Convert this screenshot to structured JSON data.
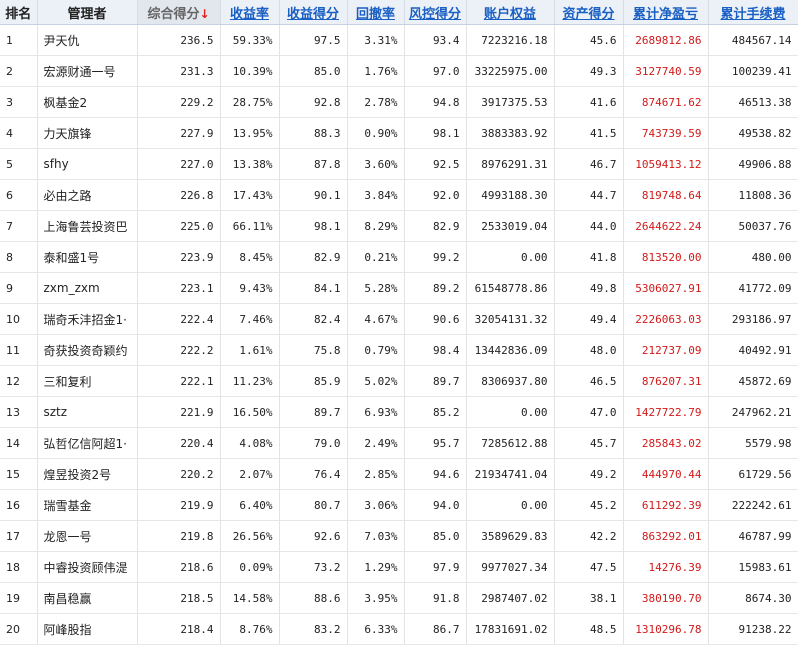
{
  "headers": {
    "rank": "排名",
    "manager": "管理者",
    "score": "综合得分",
    "sort_arrow": "↓",
    "return_rate": "收益率",
    "return_score": "收益得分",
    "drawdown": "回撤率",
    "risk_score": "风控得分",
    "equity": "账户权益",
    "asset_score": "资产得分",
    "net_pnl": "累计净盈亏",
    "fees": "累计手续费"
  },
  "rows": [
    {
      "rank": "1",
      "manager": "尹天仇",
      "score": "236.5",
      "return_rate": "59.33%",
      "return_score": "97.5",
      "drawdown": "3.31%",
      "risk_score": "93.4",
      "equity": "7223216.18",
      "asset_score": "45.6",
      "net_pnl": "2689812.86",
      "fees": "484567.14"
    },
    {
      "rank": "2",
      "manager": "宏源财通一号",
      "score": "231.3",
      "return_rate": "10.39%",
      "return_score": "85.0",
      "drawdown": "1.76%",
      "risk_score": "97.0",
      "equity": "33225975.00",
      "asset_score": "49.3",
      "net_pnl": "3127740.59",
      "fees": "100239.41"
    },
    {
      "rank": "3",
      "manager": "枫基金2",
      "score": "229.2",
      "return_rate": "28.75%",
      "return_score": "92.8",
      "drawdown": "2.78%",
      "risk_score": "94.8",
      "equity": "3917375.53",
      "asset_score": "41.6",
      "net_pnl": "874671.62",
      "fees": "46513.38"
    },
    {
      "rank": "4",
      "manager": "力天旗锋",
      "score": "227.9",
      "return_rate": "13.95%",
      "return_score": "88.3",
      "drawdown": "0.90%",
      "risk_score": "98.1",
      "equity": "3883383.92",
      "asset_score": "41.5",
      "net_pnl": "743739.59",
      "fees": "49538.82"
    },
    {
      "rank": "5",
      "manager": "sfhy",
      "score": "227.0",
      "return_rate": "13.38%",
      "return_score": "87.8",
      "drawdown": "3.60%",
      "risk_score": "92.5",
      "equity": "8976291.31",
      "asset_score": "46.7",
      "net_pnl": "1059413.12",
      "fees": "49906.88"
    },
    {
      "rank": "6",
      "manager": "必由之路",
      "score": "226.8",
      "return_rate": "17.43%",
      "return_score": "90.1",
      "drawdown": "3.84%",
      "risk_score": "92.0",
      "equity": "4993188.30",
      "asset_score": "44.7",
      "net_pnl": "819748.64",
      "fees": "11808.36"
    },
    {
      "rank": "7",
      "manager": "上海鲁芸投资巴",
      "score": "225.0",
      "return_rate": "66.11%",
      "return_score": "98.1",
      "drawdown": "8.29%",
      "risk_score": "82.9",
      "equity": "2533019.04",
      "asset_score": "44.0",
      "net_pnl": "2644622.24",
      "fees": "50037.76"
    },
    {
      "rank": "8",
      "manager": "泰和盛1号",
      "score": "223.9",
      "return_rate": "8.45%",
      "return_score": "82.9",
      "drawdown": "0.21%",
      "risk_score": "99.2",
      "equity": "0.00",
      "asset_score": "41.8",
      "net_pnl": "813520.00",
      "fees": "480.00"
    },
    {
      "rank": "9",
      "manager": "zxm_zxm",
      "score": "223.1",
      "return_rate": "9.43%",
      "return_score": "84.1",
      "drawdown": "5.28%",
      "risk_score": "89.2",
      "equity": "61548778.86",
      "asset_score": "49.8",
      "net_pnl": "5306027.91",
      "fees": "41772.09"
    },
    {
      "rank": "10",
      "manager": "瑞奇禾沣招金1·",
      "score": "222.4",
      "return_rate": "7.46%",
      "return_score": "82.4",
      "drawdown": "4.67%",
      "risk_score": "90.6",
      "equity": "32054131.32",
      "asset_score": "49.4",
      "net_pnl": "2226063.03",
      "fees": "293186.97"
    },
    {
      "rank": "11",
      "manager": "奇获投资奇颖约",
      "score": "222.2",
      "return_rate": "1.61%",
      "return_score": "75.8",
      "drawdown": "0.79%",
      "risk_score": "98.4",
      "equity": "13442836.09",
      "asset_score": "48.0",
      "net_pnl": "212737.09",
      "fees": "40492.91"
    },
    {
      "rank": "12",
      "manager": "三和复利",
      "score": "222.1",
      "return_rate": "11.23%",
      "return_score": "85.9",
      "drawdown": "5.02%",
      "risk_score": "89.7",
      "equity": "8306937.80",
      "asset_score": "46.5",
      "net_pnl": "876207.31",
      "fees": "45872.69"
    },
    {
      "rank": "13",
      "manager": "sztz",
      "score": "221.9",
      "return_rate": "16.50%",
      "return_score": "89.7",
      "drawdown": "6.93%",
      "risk_score": "85.2",
      "equity": "0.00",
      "asset_score": "47.0",
      "net_pnl": "1427722.79",
      "fees": "247962.21"
    },
    {
      "rank": "14",
      "manager": "弘哲亿信阿超1·",
      "score": "220.4",
      "return_rate": "4.08%",
      "return_score": "79.0",
      "drawdown": "2.49%",
      "risk_score": "95.7",
      "equity": "7285612.88",
      "asset_score": "45.7",
      "net_pnl": "285843.02",
      "fees": "5579.98"
    },
    {
      "rank": "15",
      "manager": "煌昱投资2号",
      "score": "220.2",
      "return_rate": "2.07%",
      "return_score": "76.4",
      "drawdown": "2.85%",
      "risk_score": "94.6",
      "equity": "21934741.04",
      "asset_score": "49.2",
      "net_pnl": "444970.44",
      "fees": "61729.56"
    },
    {
      "rank": "16",
      "manager": "瑞雪基金",
      "score": "219.9",
      "return_rate": "6.40%",
      "return_score": "80.7",
      "drawdown": "3.06%",
      "risk_score": "94.0",
      "equity": "0.00",
      "asset_score": "45.2",
      "net_pnl": "611292.39",
      "fees": "222242.61"
    },
    {
      "rank": "17",
      "manager": "龙恩一号",
      "score": "219.8",
      "return_rate": "26.56%",
      "return_score": "92.6",
      "drawdown": "7.03%",
      "risk_score": "85.0",
      "equity": "3589629.83",
      "asset_score": "42.2",
      "net_pnl": "863292.01",
      "fees": "46787.99"
    },
    {
      "rank": "18",
      "manager": "中睿投资顾伟湜",
      "score": "218.6",
      "return_rate": "0.09%",
      "return_score": "73.2",
      "drawdown": "1.29%",
      "risk_score": "97.9",
      "equity": "9977027.34",
      "asset_score": "47.5",
      "net_pnl": "14276.39",
      "fees": "15983.61"
    },
    {
      "rank": "19",
      "manager": "南昌稳赢",
      "score": "218.5",
      "return_rate": "14.58%",
      "return_score": "88.6",
      "drawdown": "3.95%",
      "risk_score": "91.8",
      "equity": "2987407.02",
      "asset_score": "38.1",
      "net_pnl": "380190.70",
      "fees": "8674.30"
    },
    {
      "rank": "20",
      "manager": "阿峰股指",
      "score": "218.4",
      "return_rate": "8.76%",
      "return_score": "83.2",
      "drawdown": "6.33%",
      "risk_score": "86.7",
      "equity": "17831691.02",
      "asset_score": "48.5",
      "net_pnl": "1310296.78",
      "fees": "91238.22"
    }
  ],
  "colors": {
    "header_link": "#1a5fc4",
    "pnl_red": "#d21919",
    "sort_arrow": "#e02020"
  }
}
